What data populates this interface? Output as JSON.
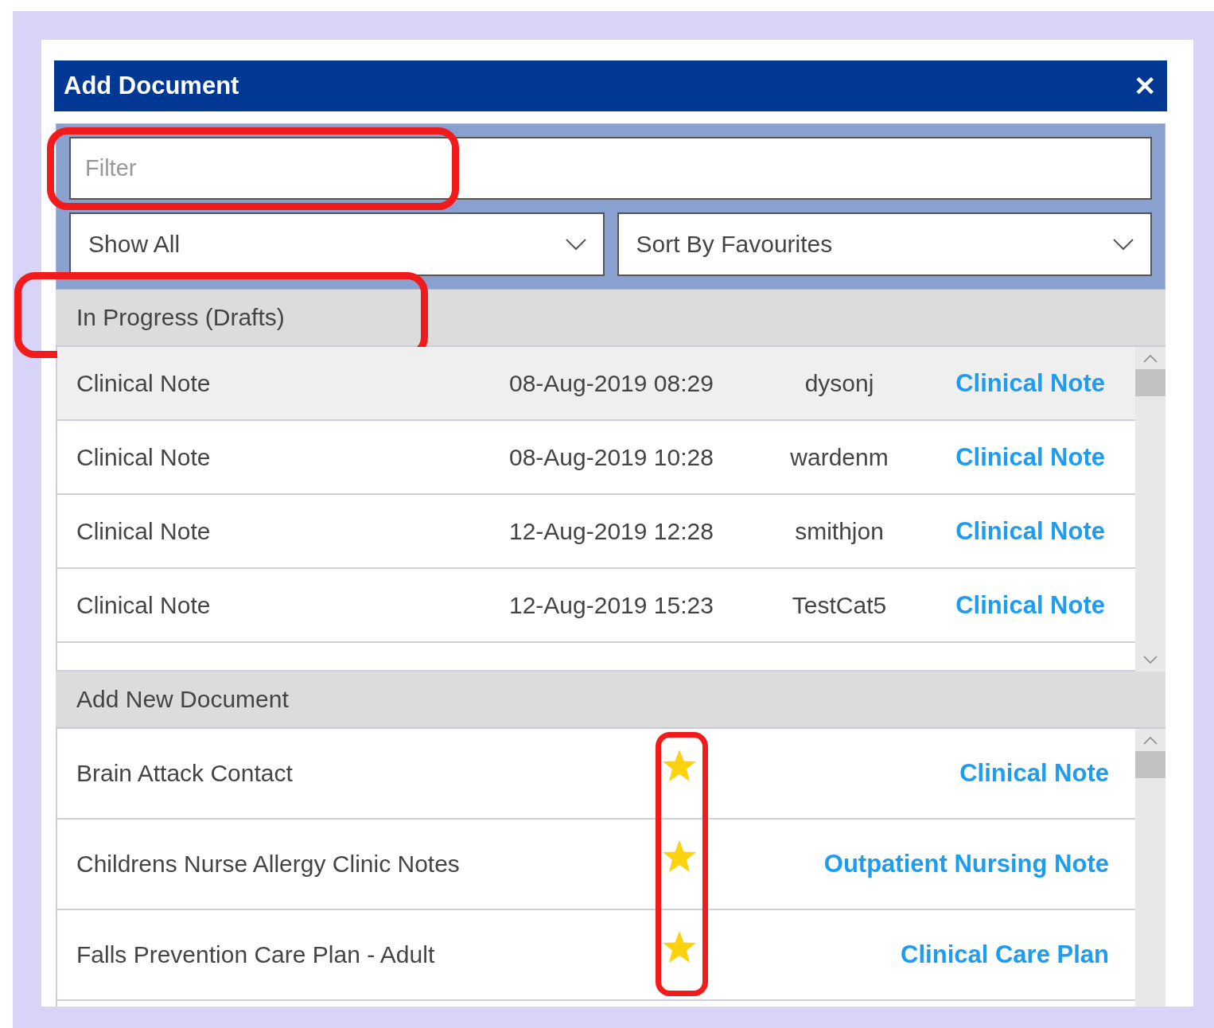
{
  "dialog": {
    "title": "Add Document",
    "close": "✕"
  },
  "filter": {
    "placeholder": "Filter",
    "highlighted": true
  },
  "dropdowns": [
    {
      "value": "Show All"
    },
    {
      "value": "Sort By Favourites"
    }
  ],
  "drafts": {
    "title": "In Progress (Drafts)",
    "highlighted": true,
    "rows": [
      {
        "name": "Clinical Note",
        "date": "08-Aug-2019 08:29",
        "user": "dysonj",
        "type": "Clinical Note",
        "selected": true
      },
      {
        "name": "Clinical Note",
        "date": "08-Aug-2019 10:28",
        "user": "wardenm",
        "type": "Clinical Note",
        "selected": false
      },
      {
        "name": "Clinical Note",
        "date": "12-Aug-2019 12:28",
        "user": "smithjon",
        "type": "Clinical Note",
        "selected": false
      },
      {
        "name": "Clinical Note",
        "date": "12-Aug-2019 15:23",
        "user": "TestCat5",
        "type": "Clinical Note",
        "selected": false
      }
    ]
  },
  "new_documents": {
    "title": "Add New Document",
    "favourites_highlighted": true,
    "rows": [
      {
        "name": "Brain Attack Contact",
        "favourite": true,
        "type": "Clinical Note"
      },
      {
        "name": "Childrens Nurse Allergy Clinic Notes",
        "favourite": true,
        "type": "Outpatient Nursing Note"
      },
      {
        "name": "Falls Prevention Care Plan - Adult",
        "favourite": true,
        "type": "Clinical Care Plan"
      }
    ]
  }
}
